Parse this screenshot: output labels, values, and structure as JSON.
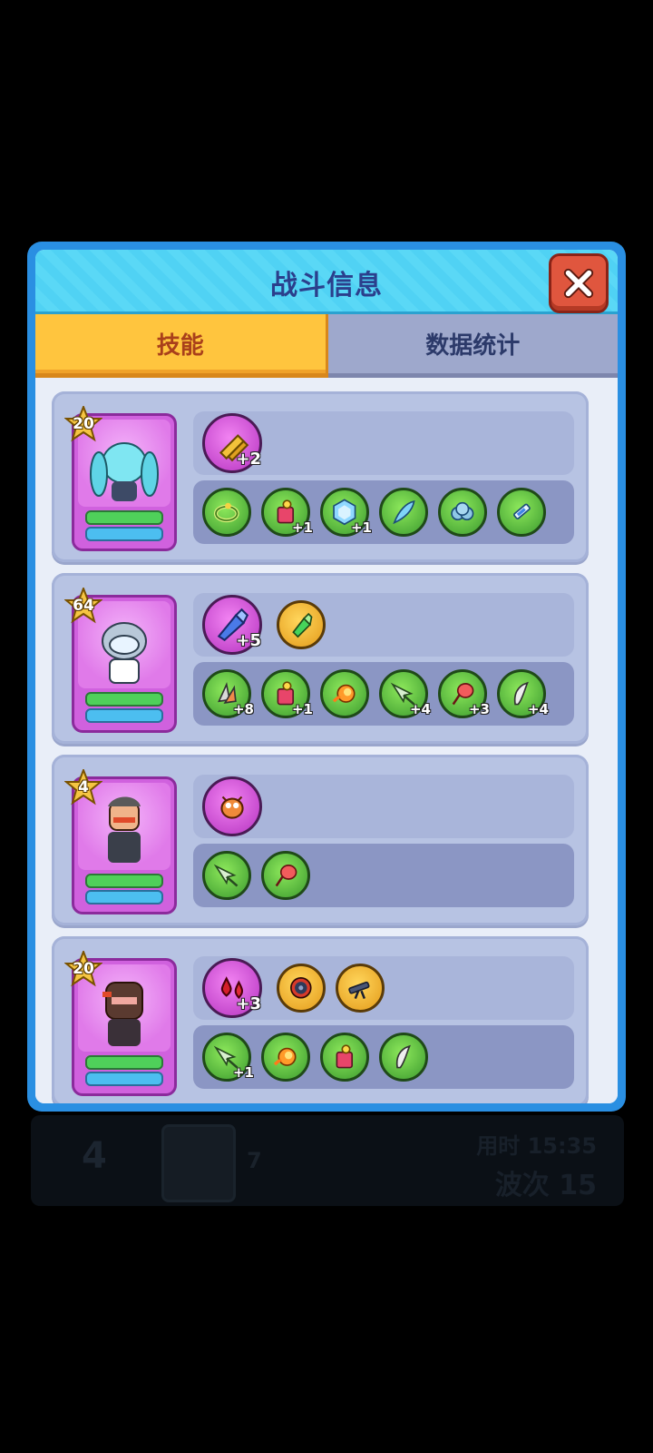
{
  "dialog": {
    "title": "战斗信息",
    "tabs": [
      {
        "label": "技能",
        "active": true
      },
      {
        "label": "数据统计",
        "active": false
      }
    ]
  },
  "background_row": {
    "rank": "4",
    "number": "7",
    "time": "用时 15:35",
    "wave": "波次 15"
  },
  "heroes": [
    {
      "level": "20",
      "hero_icon": "blue-twin-tail-girl",
      "main_skills": [
        {
          "icon": "golden-bullets-icon",
          "bonus": "+2",
          "style": "big"
        }
      ],
      "passives": [
        {
          "icon": "green-ring-icon",
          "bonus": ""
        },
        {
          "icon": "soda-can-icon",
          "bonus": "+1"
        },
        {
          "icon": "ice-crystal-icon",
          "bonus": "+1"
        },
        {
          "icon": "blue-feather-icon",
          "bonus": ""
        },
        {
          "icon": "blue-cloud-icon",
          "bonus": ""
        },
        {
          "icon": "syringe-icon",
          "bonus": ""
        }
      ]
    },
    {
      "level": "64",
      "hero_icon": "scientist",
      "main_skills": [
        {
          "icon": "blue-crystal-bullet-icon",
          "bonus": "+5",
          "style": "big"
        },
        {
          "icon": "green-bullet-icon",
          "bonus": "",
          "style": "gold"
        }
      ],
      "passives": [
        {
          "icon": "missile-cluster-icon",
          "bonus": "+8"
        },
        {
          "icon": "soda-can-icon",
          "bonus": "+1"
        },
        {
          "icon": "fireball-icon",
          "bonus": ""
        },
        {
          "icon": "green-dart-icon",
          "bonus": "+4"
        },
        {
          "icon": "red-balloon-icon",
          "bonus": "+3"
        },
        {
          "icon": "machete-icon",
          "bonus": "+4"
        }
      ]
    },
    {
      "level": "4",
      "hero_icon": "soldier",
      "main_skills": [
        {
          "icon": "orange-bug-icon",
          "bonus": "",
          "style": "big"
        }
      ],
      "passives": [
        {
          "icon": "green-dart-icon",
          "bonus": ""
        },
        {
          "icon": "red-balloon-icon",
          "bonus": ""
        }
      ]
    },
    {
      "level": "20",
      "hero_icon": "ninja",
      "main_skills": [
        {
          "icon": "blood-drops-icon",
          "bonus": "+3",
          "style": "big"
        },
        {
          "icon": "gatling-wheel-icon",
          "bonus": "",
          "style": "gold-red"
        },
        {
          "icon": "telescope-gun-icon",
          "bonus": "",
          "style": "gold"
        }
      ],
      "passives": [
        {
          "icon": "green-dart-icon",
          "bonus": "+1"
        },
        {
          "icon": "fireball-icon",
          "bonus": ""
        },
        {
          "icon": "soda-can-icon",
          "bonus": ""
        },
        {
          "icon": "machete-icon",
          "bonus": ""
        }
      ]
    }
  ],
  "colors": {
    "frame": "#2a8fe2",
    "title_bar": "#50d2f4",
    "tab_active": "#ffc53e",
    "tab_inactive": "#9ea8cc",
    "card": "#b7c3e3",
    "portrait": "#d061de"
  }
}
